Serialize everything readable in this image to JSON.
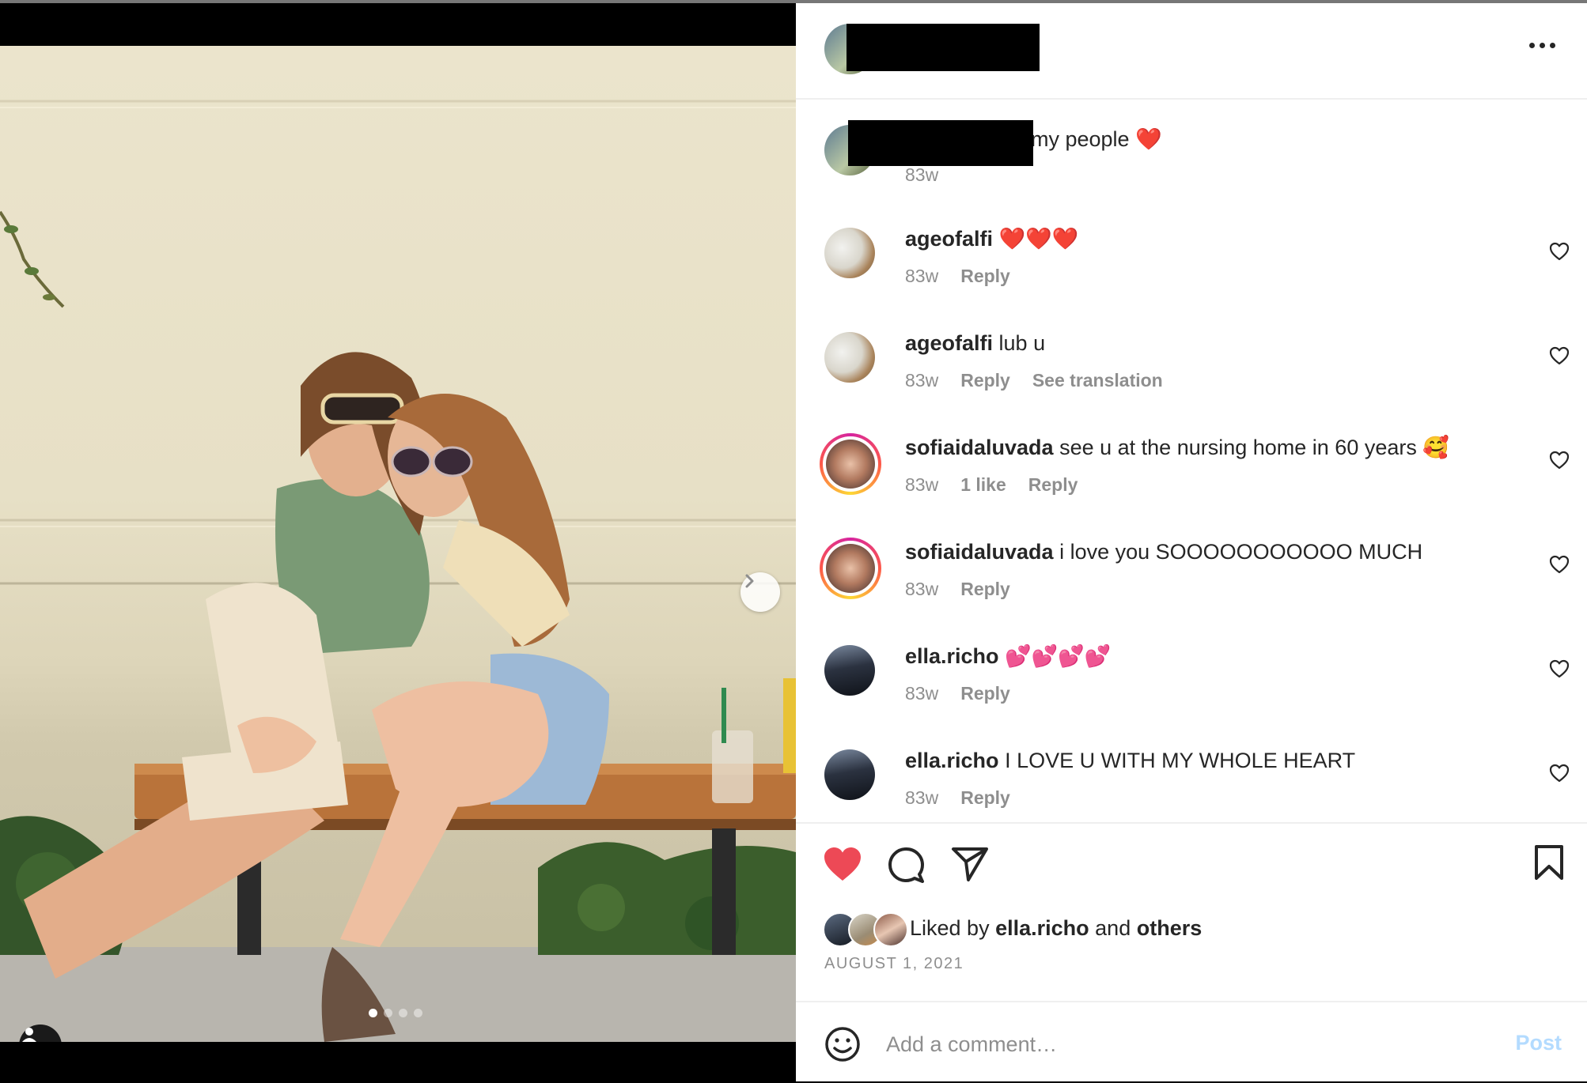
{
  "media": {
    "carousel": {
      "count": 4,
      "active_index": 0
    }
  },
  "caption": {
    "text": "w my people ❤️",
    "time": "83w"
  },
  "comments": [
    {
      "username": "ageofalfi",
      "text": "❤️❤️❤️",
      "time": "83w",
      "actions": [
        "Reply"
      ]
    },
    {
      "username": "ageofalfi",
      "text": "lub u",
      "time": "83w",
      "actions": [
        "Reply",
        "See translation"
      ]
    },
    {
      "username": "sofiaidaluvada",
      "text": "see u at the nursing home in 60 years 🥰",
      "time": "83w",
      "actions": [
        "1 like",
        "Reply"
      ]
    },
    {
      "username": "sofiaidaluvada",
      "text": "i love you SOOOOOOOOOOO MUCH",
      "time": "83w",
      "actions": [
        "Reply"
      ]
    },
    {
      "username": "ella.richo",
      "text": "💕💕💕💕",
      "time": "83w",
      "actions": [
        "Reply"
      ]
    },
    {
      "username": "ella.richo",
      "text": "I LOVE U WITH MY WHOLE HEART",
      "time": "83w",
      "actions": [
        "Reply"
      ]
    }
  ],
  "likes": {
    "prefix": "Liked by",
    "user": "ella.richo",
    "connector": "and",
    "others": "others"
  },
  "date": "AUGUST 1, 2021",
  "add_comment": {
    "placeholder": "Add a comment…",
    "post_label": "Post"
  },
  "icons": {
    "like": "heart-filled-icon",
    "comment": "speech-bubble-icon",
    "share": "paper-plane-icon",
    "save": "bookmark-icon",
    "more": "ellipsis-icon",
    "emoji": "smiley-icon",
    "next": "chevron-right-icon",
    "tags": "person-icon"
  },
  "colors": {
    "like_red": "#ed4956",
    "post_disabled": "#b3dbff",
    "muted_text": "#8e8e8e"
  }
}
